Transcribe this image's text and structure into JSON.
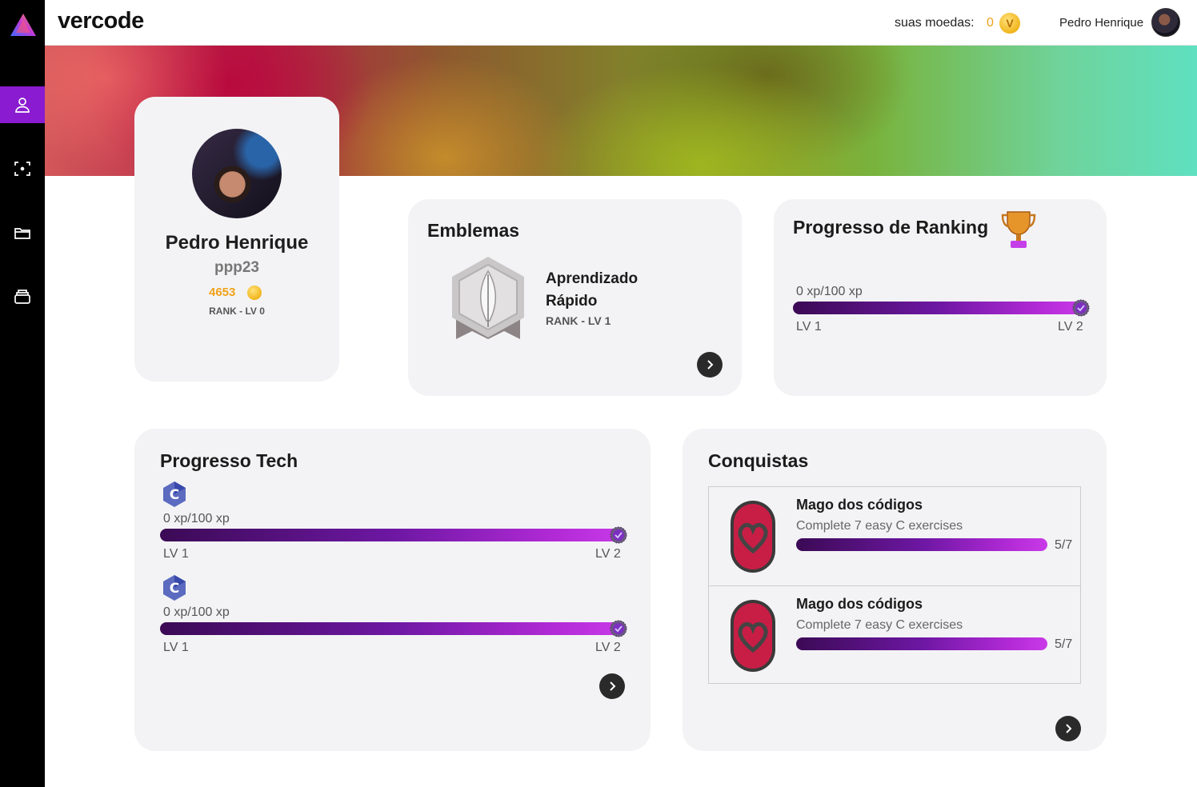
{
  "app": {
    "brand": "vercode"
  },
  "header": {
    "coins_label": "suas moedas:",
    "coins_value": "0",
    "coin_symbol": "V",
    "user_name": "Pedro Henrique"
  },
  "sidebar": {
    "items": [
      {
        "icon": "user-icon",
        "active": true
      },
      {
        "icon": "focus-icon",
        "active": false
      },
      {
        "icon": "folder-icon",
        "active": false
      },
      {
        "icon": "archive-icon",
        "active": false
      }
    ]
  },
  "profile": {
    "name": "Pedro Henrique",
    "username": "ppp23",
    "xp": "4653",
    "rank": "RANK - LV 0"
  },
  "emblemas": {
    "title": "Emblemas",
    "badge_title": "Aprendizado Rápido",
    "badge_rank": "RANK - LV 1"
  },
  "ranking": {
    "title": "Progresso de Ranking",
    "xp": "0 xp/100 xp",
    "lv_start": "LV 1",
    "lv_end": "LV 2",
    "progress": 1.0
  },
  "tech": {
    "title": "Progresso Tech",
    "items": [
      {
        "icon": "c-language-icon",
        "xp": "0 xp/100 xp",
        "lv_start": "LV 1",
        "lv_end": "LV 2",
        "progress": 1.0
      },
      {
        "icon": "c-language-icon",
        "xp": "0 xp/100 xp",
        "lv_start": "LV 1",
        "lv_end": "LV 2",
        "progress": 1.0
      }
    ]
  },
  "conquistas": {
    "title": "Conquistas",
    "items": [
      {
        "title": "Mago dos códigos",
        "desc": "Complete 7 easy C exercises",
        "count": "5/7",
        "progress": 1.0
      },
      {
        "title": "Mago dos códigos",
        "desc": "Complete 7 easy C exercises",
        "count": "5/7",
        "progress": 1.0
      }
    ]
  },
  "colors": {
    "accent": "#8a1bd0",
    "coin": "#f0a21a",
    "card": "#f3f3f5",
    "sidebar": "#000000"
  }
}
